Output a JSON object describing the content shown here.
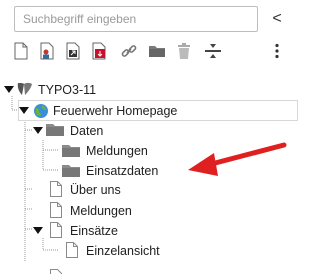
{
  "search": {
    "placeholder": "Suchbegriff eingeben",
    "collapse_label": "<"
  },
  "tree": {
    "root": "TYPO3-11",
    "site": "Feuerwehr Homepage",
    "daten": "Daten",
    "daten_children": [
      "Meldungen",
      "Einsatzdaten"
    ],
    "ueber_uns": "Über uns",
    "meldungen": "Meldungen",
    "einsaetze": "Einsätze",
    "einzelansicht": "Einzelansicht"
  },
  "toolbar": {
    "icons": [
      "page-new-icon",
      "page-user-icon",
      "page-shortcut-icon",
      "page-mountpoint-icon",
      "link-icon",
      "folder-icon",
      "trash-icon",
      "divider-icon",
      "more-icon"
    ]
  },
  "colors": {
    "arrow": "#e02020",
    "folder": "#7a7a7a",
    "page_border": "#8a8a8a"
  }
}
